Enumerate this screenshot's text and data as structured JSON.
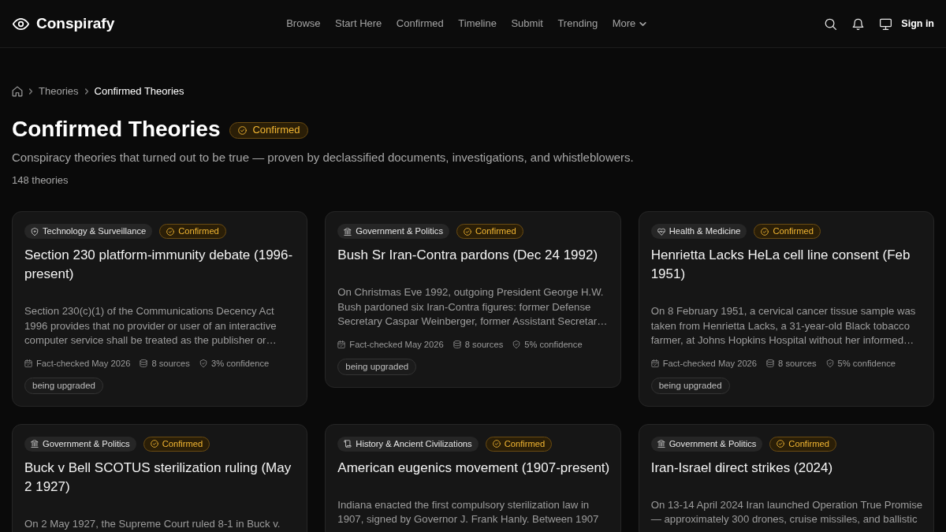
{
  "brand": {
    "name": "Conspirafy"
  },
  "nav": [
    {
      "label": "Browse",
      "kind": "link"
    },
    {
      "label": "Start Here",
      "kind": "link"
    },
    {
      "label": "Confirmed",
      "kind": "link"
    },
    {
      "label": "Timeline",
      "kind": "link"
    },
    {
      "label": "Submit",
      "kind": "link"
    },
    {
      "label": "Trending",
      "kind": "link"
    },
    {
      "label": "More",
      "kind": "dropdown"
    }
  ],
  "header_actions": {
    "sign_in": "Sign in"
  },
  "breadcrumb": [
    {
      "label": "Theories",
      "current": false
    },
    {
      "label": "Confirmed Theories",
      "current": true
    }
  ],
  "page": {
    "title": "Confirmed Theories",
    "badge": {
      "label": "Confirmed",
      "kind": "confirmed"
    },
    "description": "Conspiracy theories that turned out to be true — proven by declassified documents, investigations, and whistleblowers.",
    "count": "148 theories"
  },
  "cards": [
    {
      "category": {
        "label": "Technology & Surveillance",
        "kind": "technology"
      },
      "status": {
        "label": "Confirmed",
        "kind": "confirmed"
      },
      "title": "Section 230 platform-immunity debate (1996-present)",
      "summary": "Section 230(c)(1) of the Communications Decency Act 1996 provides that no provider or user of an interactive computer service shall be treated as the publisher or…",
      "meta": {
        "fact_checked": "Fact-checked May 2026",
        "sources": "8 sources",
        "confidence": "3% confidence"
      },
      "tags": [
        "being upgraded"
      ]
    },
    {
      "category": {
        "label": "Government & Politics",
        "kind": "government"
      },
      "status": {
        "label": "Confirmed",
        "kind": "confirmed"
      },
      "title": "Bush Sr Iran-Contra pardons (Dec 24 1992)",
      "summary": "On Christmas Eve 1992, outgoing President George H.W. Bush pardoned six Iran-Contra figures: former Defense Secretary Caspar Weinberger, former Assistant Secretar…",
      "meta": {
        "fact_checked": "Fact-checked May 2026",
        "sources": "8 sources",
        "confidence": "5% confidence"
      },
      "tags": [
        "being upgraded"
      ]
    },
    {
      "category": {
        "label": "Health & Medicine",
        "kind": "health"
      },
      "status": {
        "label": "Confirmed",
        "kind": "confirmed"
      },
      "title": "Henrietta Lacks HeLa cell line consent (Feb 1951)",
      "summary": "On 8 February 1951, a cervical cancer tissue sample was taken from Henrietta Lacks, a 31-year-old Black tobacco farmer, at Johns Hopkins Hospital without her informed…",
      "meta": {
        "fact_checked": "Fact-checked May 2026",
        "sources": "8 sources",
        "confidence": "5% confidence"
      },
      "tags": [
        "being upgraded"
      ]
    },
    {
      "category": {
        "label": "Government & Politics",
        "kind": "government"
      },
      "status": {
        "label": "Confirmed",
        "kind": "confirmed"
      },
      "title": "Buck v Bell SCOTUS sterilization ruling (May 2 1927)",
      "summary": "On 2 May 1927, the Supreme Court ruled 8-1 in Buck v."
    },
    {
      "category": {
        "label": "History & Ancient Civilizations",
        "kind": "history"
      },
      "status": {
        "label": "Confirmed",
        "kind": "confirmed"
      },
      "title": "American eugenics movement (1907-present)",
      "summary": "Indiana enacted the first compulsory sterilization law in 1907, signed by Governor J. Frank Hanly. Between 1907"
    },
    {
      "category": {
        "label": "Government & Politics",
        "kind": "government"
      },
      "status": {
        "label": "Confirmed",
        "kind": "confirmed"
      },
      "title": "Iran-Israel direct strikes (2024)",
      "summary": "On 13-14 April 2024 Iran launched Operation True Promise — approximately 300 drones, cruise missiles, and ballistic"
    }
  ]
}
